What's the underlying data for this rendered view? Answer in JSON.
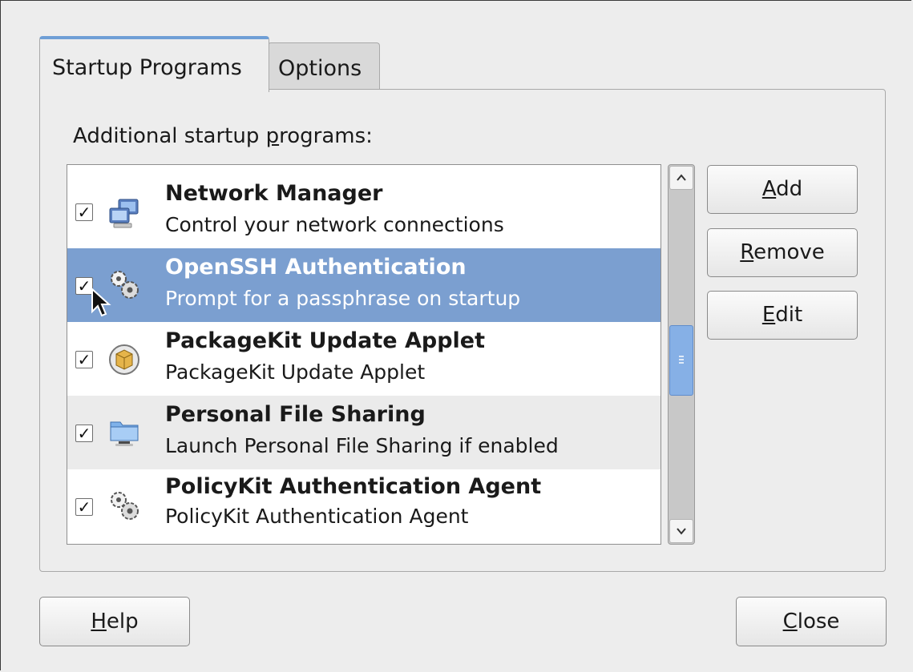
{
  "tabs": [
    {
      "label": "Startup Programs",
      "active": true
    },
    {
      "label": "Options",
      "active": false
    }
  ],
  "section_label": {
    "pre": "Additional startup ",
    "mnemonic": "p",
    "post": "rograms:"
  },
  "programs": [
    {
      "title": "Network Manager",
      "description": "Control your network connections",
      "checked": true,
      "icon": "network-computers-icon",
      "selected": false
    },
    {
      "title": "OpenSSH Authentication",
      "description": "Prompt for a passphrase on startup",
      "checked": true,
      "icon": "gears-icon",
      "selected": true
    },
    {
      "title": "PackageKit Update Applet",
      "description": "PackageKit Update Applet",
      "checked": true,
      "icon": "package-update-icon",
      "selected": false
    },
    {
      "title": "Personal File Sharing",
      "description": "Launch Personal File Sharing if enabled",
      "checked": true,
      "icon": "shared-folder-icon",
      "selected": false
    },
    {
      "title": "PolicyKit Authentication Agent",
      "description": "PolicyKit Authentication Agent",
      "checked": true,
      "icon": "gears-icon",
      "selected": false
    }
  ],
  "side_buttons": {
    "add": {
      "mnemonic": "A",
      "rest": "dd"
    },
    "remove": {
      "mnemonic": "R",
      "rest": "emove"
    },
    "edit": {
      "mnemonic": "E",
      "rest": "dit"
    }
  },
  "footer_buttons": {
    "help": {
      "mnemonic": "H",
      "rest": "elp"
    },
    "close": {
      "mnemonic": "C",
      "rest": "lose"
    }
  },
  "colors": {
    "selection": "#7b9fd0",
    "tab_accent": "#6f9fd6",
    "scroll_thumb": "#86b0e6"
  }
}
